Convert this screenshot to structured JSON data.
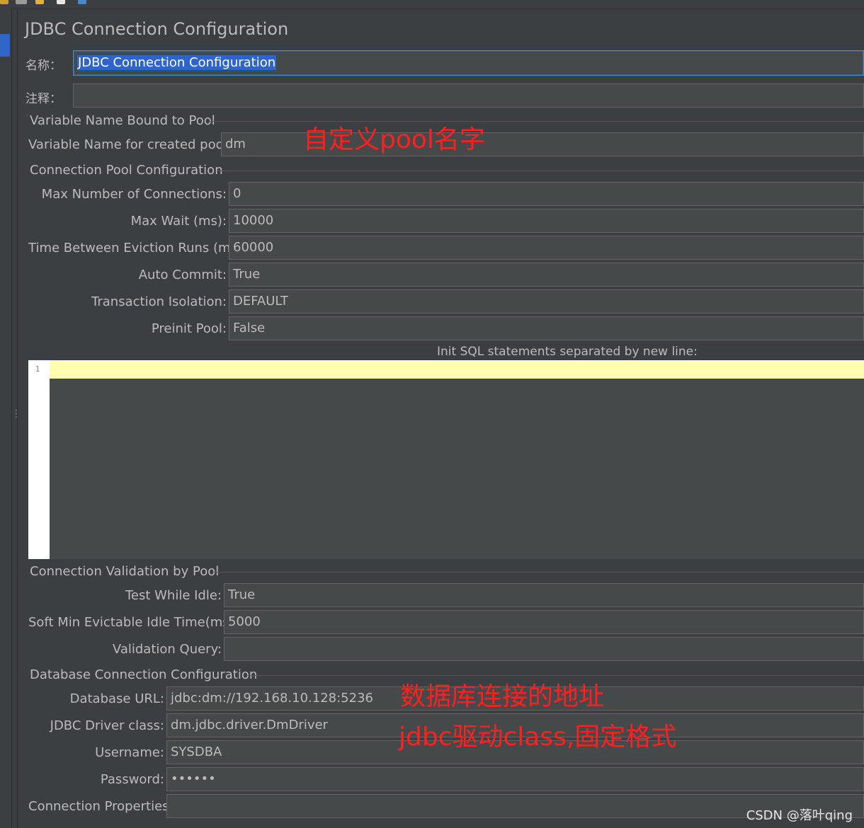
{
  "panel": {
    "title": "JDBC Connection Configuration"
  },
  "name_field": {
    "label": "名称：",
    "value": "JDBC Connection Configuration"
  },
  "comment_field": {
    "label": "注释：",
    "value": ""
  },
  "variable_section": {
    "title": "Variable Name Bound to Pool",
    "pool_var_label": "Variable Name for created pool:",
    "pool_var_value": "dm"
  },
  "pool_section": {
    "title": "Connection Pool Configuration",
    "max_connections_label": "Max Number of Connections:",
    "max_connections_value": "0",
    "max_wait_label": "Max Wait (ms):",
    "max_wait_value": "10000",
    "eviction_label": "Time Between Eviction Runs (ms):",
    "eviction_value": "60000",
    "auto_commit_label": "Auto Commit:",
    "auto_commit_value": "True",
    "isolation_label": "Transaction Isolation:",
    "isolation_value": "DEFAULT",
    "preinit_label": "Preinit Pool:",
    "preinit_value": "False",
    "init_sql_label": "Init SQL statements separated by new line:",
    "init_sql_line_number": "1"
  },
  "validation_section": {
    "title": "Connection Validation by Pool",
    "test_idle_label": "Test While Idle:",
    "test_idle_value": "True",
    "soft_min_label": "Soft Min Evictable Idle Time(ms):",
    "soft_min_value": "5000",
    "validation_query_label": "Validation Query:",
    "validation_query_value": ""
  },
  "database_section": {
    "title": "Database Connection Configuration",
    "url_label": "Database URL:",
    "url_value": "jdbc:dm://192.168.10.128:5236",
    "driver_label": "JDBC Driver class:",
    "driver_value": "dm.jdbc.driver.DmDriver",
    "username_label": "Username:",
    "username_value": "SYSDBA",
    "password_label": "Password:",
    "password_value": "••••••",
    "properties_label": "Connection Properties:",
    "properties_value": ""
  },
  "annotations": {
    "pool_name_note": "自定义pool名字",
    "url_note": "数据库连接的地址",
    "driver_note": "jdbc驱动class,固定格式"
  },
  "watermark": "CSDN @落叶qing",
  "colors": {
    "background": "#3c3f41",
    "field": "#45494a",
    "selection": "#2f65ca",
    "current_line": "#fffdb0",
    "annotation": "#ff1f1f"
  }
}
